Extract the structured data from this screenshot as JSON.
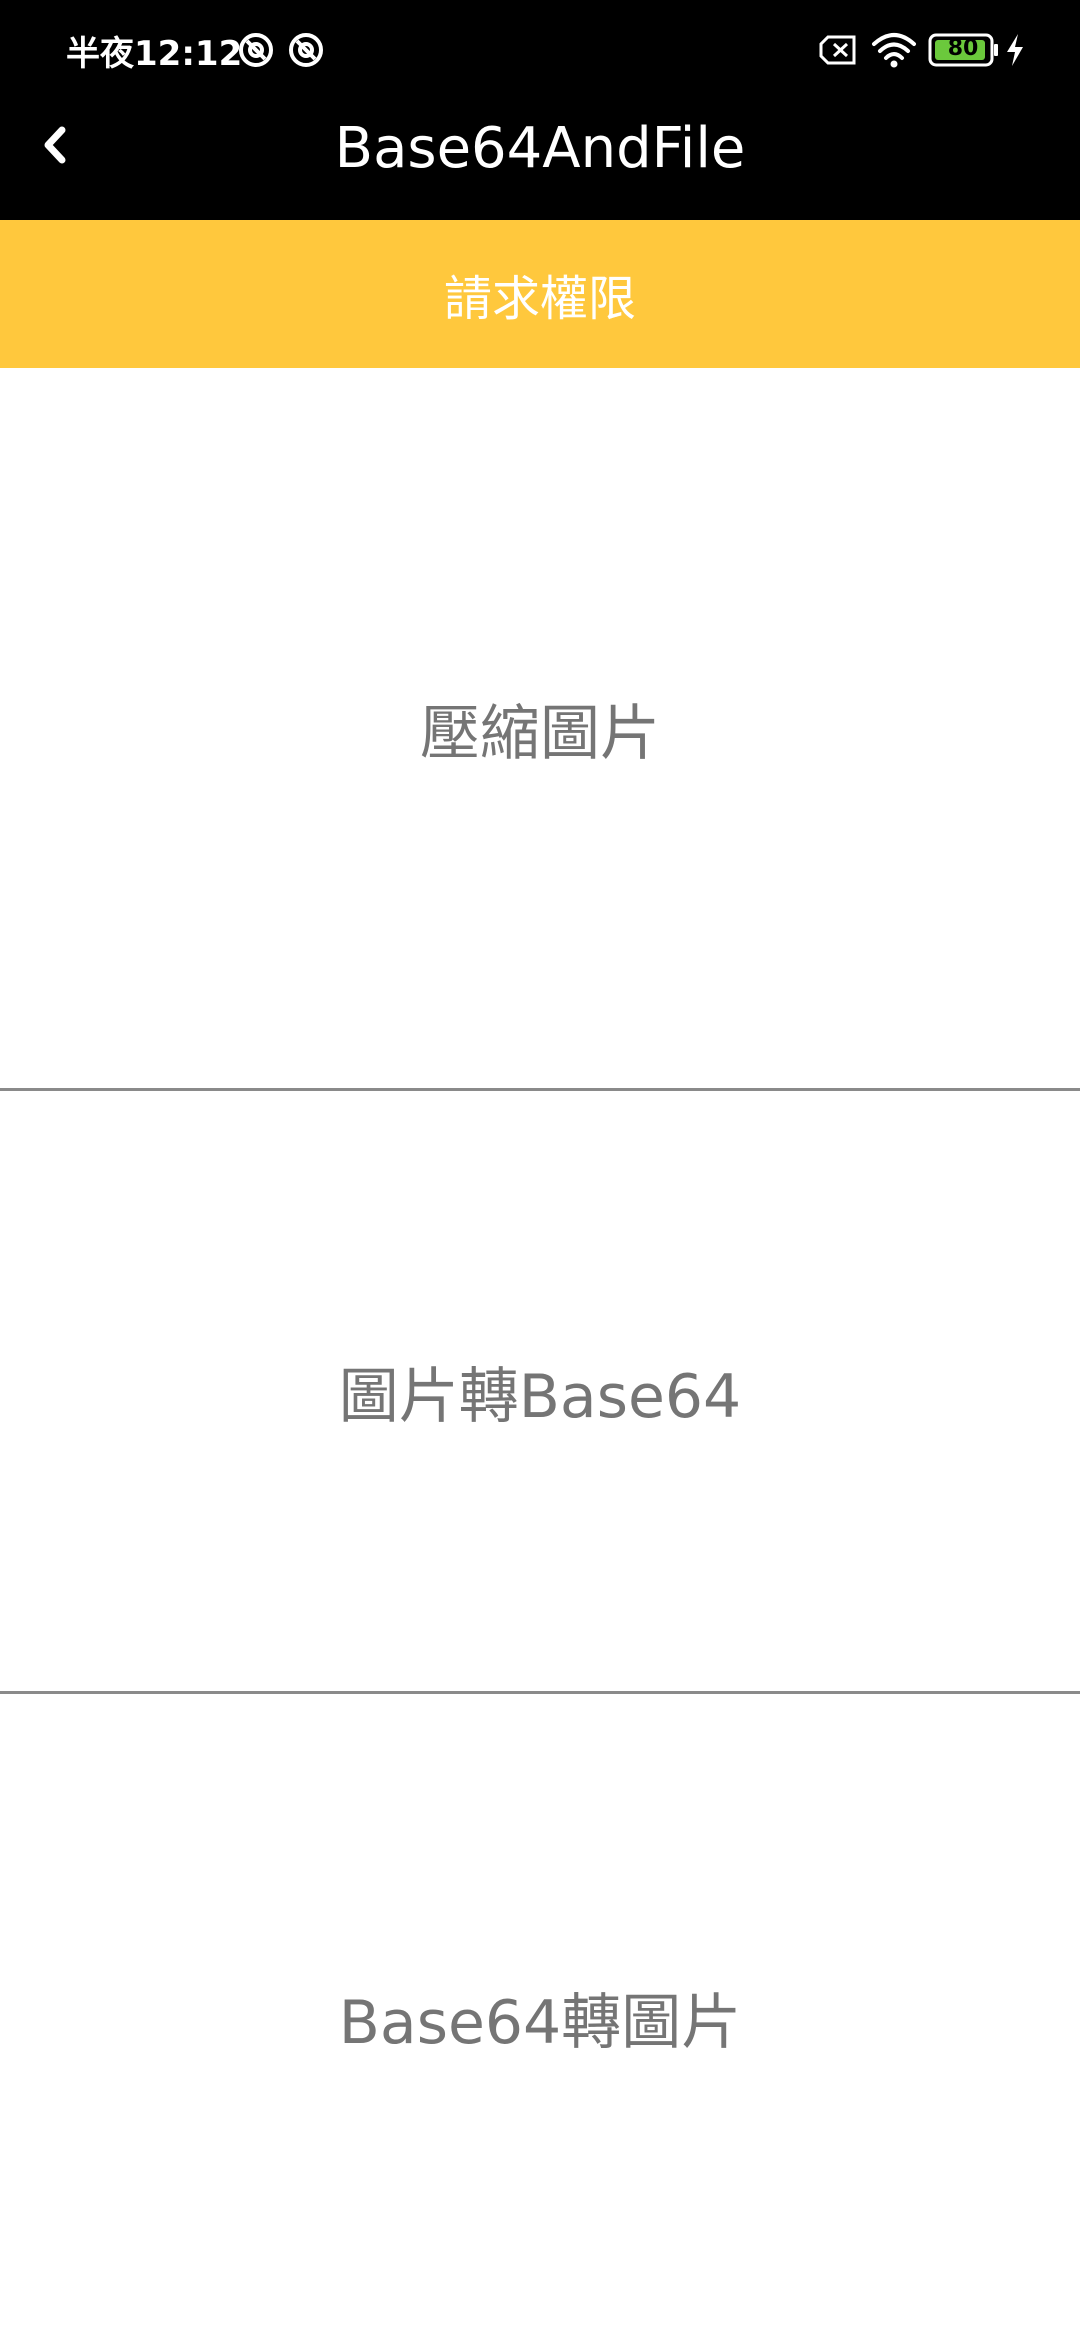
{
  "status_bar": {
    "time": "半夜12:12",
    "battery_level": "80",
    "icons": [
      "vpn-key-icon",
      "vpn-key-icon",
      "sim-disabled-icon",
      "wifi-icon",
      "battery-icon",
      "charging-bolt-icon"
    ]
  },
  "app_bar": {
    "title": "Base64AndFile",
    "back_icon": "chevron-left-icon"
  },
  "permission_button": {
    "label": "請求權限",
    "color": "#FFC83D"
  },
  "actions": [
    {
      "label": "壓縮圖片"
    },
    {
      "label": "圖片轉Base64"
    },
    {
      "label": "Base64轉圖片"
    }
  ]
}
